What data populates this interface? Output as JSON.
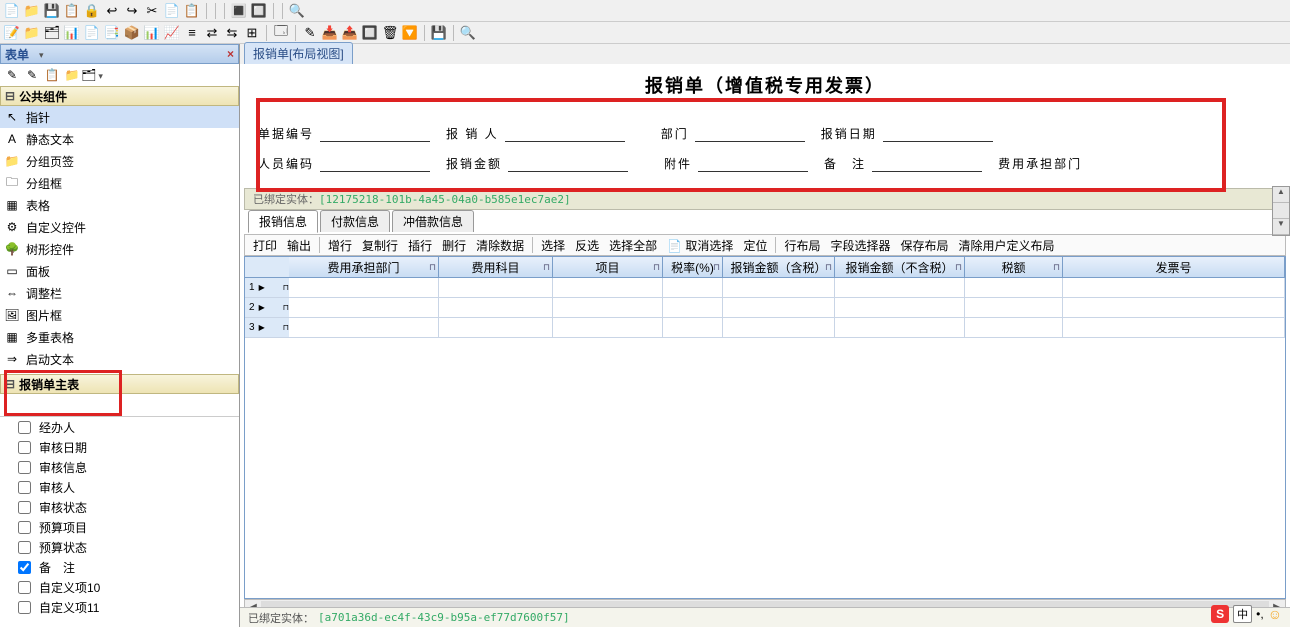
{
  "toolbar1_icons": [
    "📄",
    "📁",
    "💾",
    "📋",
    "🔒",
    "↩",
    "↪",
    "✂",
    "📄",
    "📋",
    "",
    "",
    "",
    "🔳",
    "🔲",
    "",
    "",
    "🔍"
  ],
  "toolbar2_icons": [
    "📝",
    "📁",
    "🗂",
    "📊",
    "📄",
    "📑",
    "📦",
    "📊",
    "📈",
    "≡",
    "⇄",
    "⇆",
    "⊞",
    "",
    "🗔",
    "",
    "✎",
    "📥",
    "📤",
    "🔲",
    "🗑",
    "🔽",
    "",
    "💾",
    "",
    "🔍"
  ],
  "left_panel": {
    "title": "表单",
    "mini_icons": [
      "✎",
      "✎",
      "📋",
      "📁",
      "🗂"
    ],
    "group1_title": "公共组件",
    "palette": [
      {
        "icon": "↖",
        "label": "指针",
        "sel": true
      },
      {
        "icon": "A",
        "label": "静态文本"
      },
      {
        "icon": "📁",
        "label": "分组页签"
      },
      {
        "icon": "🗀",
        "label": "分组框"
      },
      {
        "icon": "▦",
        "label": "表格"
      },
      {
        "icon": "⚙",
        "label": "自定义控件"
      },
      {
        "icon": "🌳",
        "label": "树形控件"
      },
      {
        "icon": "▭",
        "label": "面板"
      },
      {
        "icon": "⇔",
        "label": "调整栏"
      },
      {
        "icon": "🖼",
        "label": "图片框"
      },
      {
        "icon": "▦",
        "label": "多重表格"
      },
      {
        "icon": "⇒",
        "label": "启动文本"
      }
    ],
    "group2_title": "报销单主表",
    "checks": [
      {
        "label": "经办人",
        "checked": false
      },
      {
        "label": "审核日期",
        "checked": false
      },
      {
        "label": "审核信息",
        "checked": false
      },
      {
        "label": "审核人",
        "checked": false
      },
      {
        "label": "审核状态",
        "checked": false
      },
      {
        "label": "预算项目",
        "checked": false
      },
      {
        "label": "预算状态",
        "checked": false
      },
      {
        "label": "备　注",
        "checked": true
      },
      {
        "label": "自定义项10",
        "checked": false
      },
      {
        "label": "自定义项11",
        "checked": false
      }
    ]
  },
  "tab_title": "报销单[布局视图]",
  "doc_title": "报销单（增值税专用发票）",
  "form_labels": {
    "bill_no": "单据编号",
    "person": "报 销 人",
    "dept": "部门",
    "date": "报销日期",
    "emp_code": "人员编码",
    "amount": "报销金额",
    "attach": "附件",
    "remark": "备　注",
    "cost_dept": "费用承担部门"
  },
  "entity_bar_prefix": "已绑定实体：",
  "entity_bar_value": "[12175218-101b-4a45-04a0-b585e1ec7ae2]",
  "sub_tabs": [
    "报销信息",
    "付款信息",
    "冲借款信息"
  ],
  "grid_toolbar": [
    "打印",
    "输出",
    "",
    "增行",
    "复制行",
    "插行",
    "删行",
    "清除数据",
    "",
    "选择",
    "反选",
    "选择全部",
    "📄 取消选择",
    "定位",
    "",
    "行布局",
    "字段选择器",
    "保存布局",
    "清除用户定义布局"
  ],
  "grid_columns": [
    "费用承担部门",
    "费用科目",
    "项目",
    "税率(%)",
    "报销金额（含税）",
    "报销金额（不含税）",
    "税额",
    "发票号"
  ],
  "grid_rows": [
    1,
    2,
    3
  ],
  "status_prefix": "已绑定实体：",
  "status_guid": "[a701a36d-ec4f-43c9-b95a-ef77d7600f57]",
  "ime": {
    "s": "S",
    "zh": "中",
    "punct": "•,"
  }
}
